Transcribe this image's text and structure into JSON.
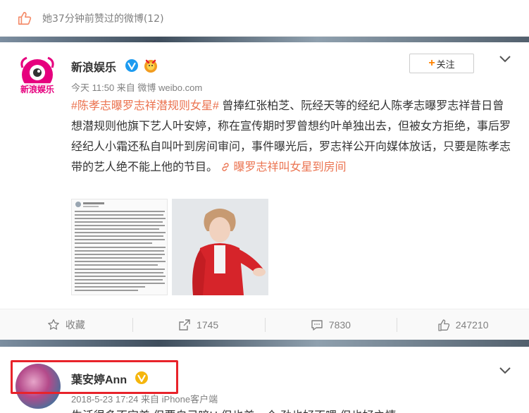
{
  "notice": {
    "text": "她37分钟前赞过的微博(12)",
    "icon": "thumbs-up-icon"
  },
  "post": {
    "author": "新浪娱乐",
    "avatar_text": "新浪娱乐",
    "follow_label": "关注",
    "meta": "今天 11:50 来自 微博 weibo.com",
    "topic": "#陈孝志曝罗志祥潜规则女星#",
    "body": " 曾捧红张柏芝、阮经天等的经纪人陈孝志曝罗志祥昔日曾想潜规则他旗下艺人叶安婷，称在宣传期时罗曾想约叶单独出去，但被女方拒绝，事后罗经纪人小霜还私自叫叶到房间审问，事件曝光后，罗志祥公开向媒体放话，只要是陈孝志带的艺人绝不能上他的节目。 ",
    "link_text": "曝罗志祥叫女星到房间",
    "actions": {
      "favorite": "收藏",
      "repost": "1745",
      "comment": "7830",
      "like": "247210"
    }
  },
  "post2": {
    "author": "葉安婷Ann",
    "meta": "2018-5-23 17:24 来自 iPhone客户端",
    "peek_text": "生活很多不完美 但要自己喑Ц 但也美一个 劲也好不喂 但也好之情"
  },
  "colors": {
    "accent": "#eb7350",
    "follow_plus": "#ff8200",
    "highlight": "#e8232a",
    "vip_blue": "#1d9bf0",
    "vip_gold": "#f5b60d"
  }
}
